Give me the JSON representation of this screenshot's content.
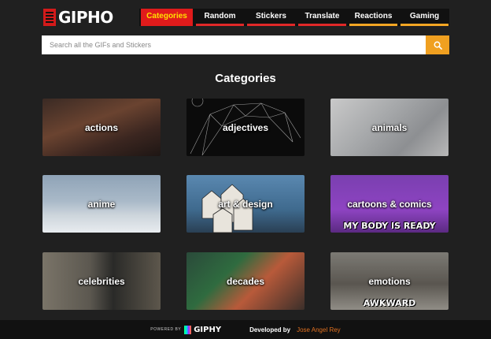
{
  "logo": {
    "text": "GIPHO",
    "icon": "logo-icon"
  },
  "nav": {
    "tabs": [
      {
        "label": "Categories",
        "active": true
      },
      {
        "label": "Random"
      },
      {
        "label": "Stickers"
      },
      {
        "label": "Translate"
      },
      {
        "label": "Reactions"
      },
      {
        "label": "Gaming"
      }
    ]
  },
  "search": {
    "placeholder": "Search all the GIFs and Stickers",
    "value": "",
    "icon": "search-icon"
  },
  "main": {
    "title": "Categories",
    "categories": [
      {
        "label": "actions"
      },
      {
        "label": "adjectives"
      },
      {
        "label": "animals"
      },
      {
        "label": "anime"
      },
      {
        "label": "art & design"
      },
      {
        "label": "cartoons & comics",
        "caption": "MY BODY IS READY"
      },
      {
        "label": "celebrities"
      },
      {
        "label": "decades"
      },
      {
        "label": "emotions",
        "caption": "AWKWARD"
      }
    ]
  },
  "footer": {
    "powered_by": "POWERED BY",
    "brand": "GIPHY",
    "developed_by": "Developed by",
    "developer": "Jose Angel Rey"
  },
  "colors": {
    "background": "#202020",
    "active_tab": "#e01b1b",
    "active_tab_text": "#ffe000",
    "search_button": "#f0a020",
    "developer_link": "#e07020"
  }
}
